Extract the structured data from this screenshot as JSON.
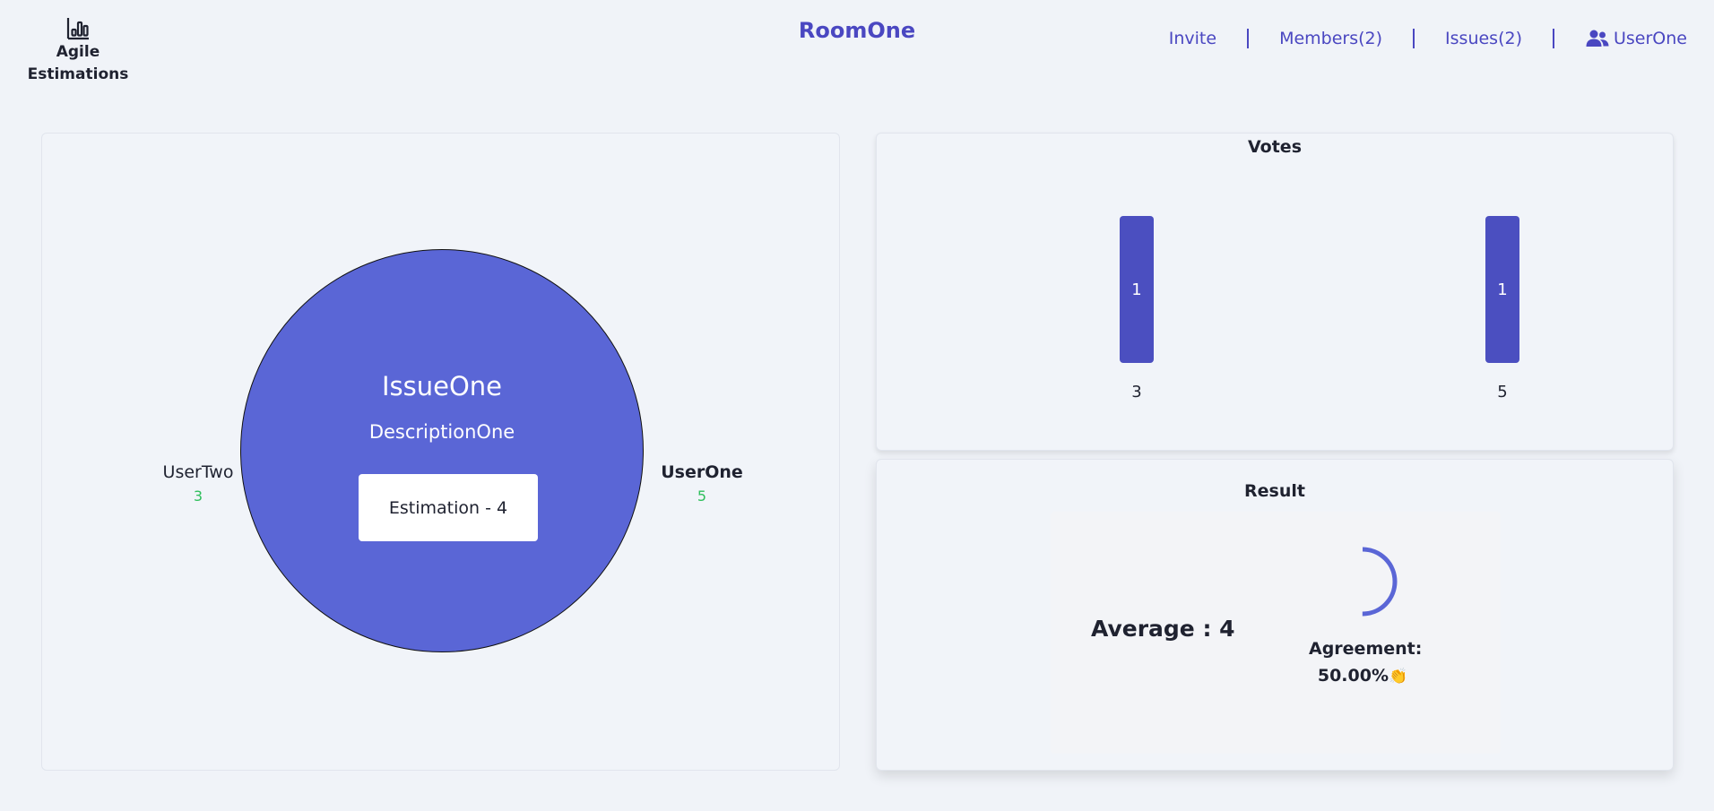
{
  "header": {
    "logo_line1": "Agile",
    "logo_line2": "Estimations",
    "room_title": "RoomOne",
    "nav": {
      "invite": "Invite",
      "members": "Members(2)",
      "issues": "Issues(2)",
      "user": "UserOne"
    }
  },
  "issue": {
    "title": "IssueOne",
    "description": "DescriptionOne",
    "estimation_label": "Estimation - 4"
  },
  "participants": [
    {
      "name": "UserTwo",
      "vote": "3"
    },
    {
      "name": "UserOne",
      "vote": "5"
    }
  ],
  "votes": {
    "title": "Votes",
    "chart_data": {
      "type": "bar",
      "categories": [
        "3",
        "5"
      ],
      "values": [
        1,
        1
      ],
      "title": "Votes"
    }
  },
  "result": {
    "title": "Result",
    "average_label": "Average : 4",
    "agreement_label": "Agreement:",
    "agreement_value": "50.00%",
    "agreement_fraction": 0.5,
    "agreement_emoji": "👏"
  },
  "colors": {
    "accent": "#4a47c1",
    "circle": "#5a66d6",
    "bar": "#4b4fc0",
    "vote_value": "#2fbf5c",
    "background": "#f0f3f8"
  },
  "icons": {
    "logo": "bar-chart-icon",
    "user": "users-icon",
    "agreement": "clapping-hands-icon"
  }
}
